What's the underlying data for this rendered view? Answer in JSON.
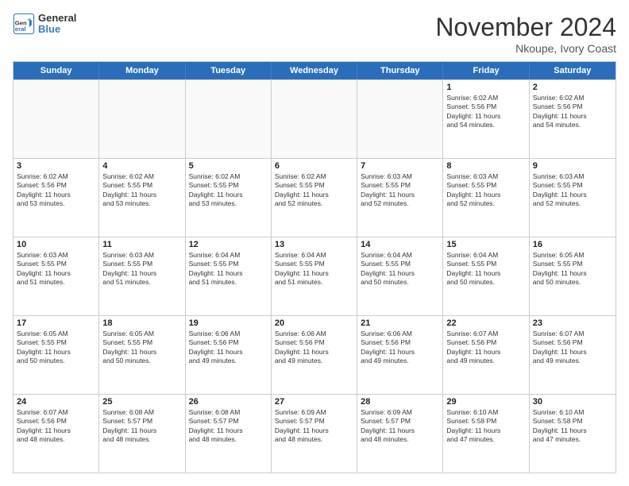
{
  "header": {
    "logo": {
      "line1": "General",
      "line2": "Blue"
    },
    "month": "November 2024",
    "location": "Nkoupe, Ivory Coast"
  },
  "weekdays": [
    "Sunday",
    "Monday",
    "Tuesday",
    "Wednesday",
    "Thursday",
    "Friday",
    "Saturday"
  ],
  "rows": [
    [
      {
        "day": "",
        "info": "",
        "empty": true
      },
      {
        "day": "",
        "info": "",
        "empty": true
      },
      {
        "day": "",
        "info": "",
        "empty": true
      },
      {
        "day": "",
        "info": "",
        "empty": true
      },
      {
        "day": "",
        "info": "",
        "empty": true
      },
      {
        "day": "1",
        "info": "Sunrise: 6:02 AM\nSunset: 5:56 PM\nDaylight: 11 hours\nand 54 minutes.",
        "empty": false
      },
      {
        "day": "2",
        "info": "Sunrise: 6:02 AM\nSunset: 5:56 PM\nDaylight: 11 hours\nand 54 minutes.",
        "empty": false
      }
    ],
    [
      {
        "day": "3",
        "info": "Sunrise: 6:02 AM\nSunset: 5:56 PM\nDaylight: 11 hours\nand 53 minutes.",
        "empty": false
      },
      {
        "day": "4",
        "info": "Sunrise: 6:02 AM\nSunset: 5:55 PM\nDaylight: 11 hours\nand 53 minutes.",
        "empty": false
      },
      {
        "day": "5",
        "info": "Sunrise: 6:02 AM\nSunset: 5:55 PM\nDaylight: 11 hours\nand 53 minutes.",
        "empty": false
      },
      {
        "day": "6",
        "info": "Sunrise: 6:02 AM\nSunset: 5:55 PM\nDaylight: 11 hours\nand 52 minutes.",
        "empty": false
      },
      {
        "day": "7",
        "info": "Sunrise: 6:03 AM\nSunset: 5:55 PM\nDaylight: 11 hours\nand 52 minutes.",
        "empty": false
      },
      {
        "day": "8",
        "info": "Sunrise: 6:03 AM\nSunset: 5:55 PM\nDaylight: 11 hours\nand 52 minutes.",
        "empty": false
      },
      {
        "day": "9",
        "info": "Sunrise: 6:03 AM\nSunset: 5:55 PM\nDaylight: 11 hours\nand 52 minutes.",
        "empty": false
      }
    ],
    [
      {
        "day": "10",
        "info": "Sunrise: 6:03 AM\nSunset: 5:55 PM\nDaylight: 11 hours\nand 51 minutes.",
        "empty": false
      },
      {
        "day": "11",
        "info": "Sunrise: 6:03 AM\nSunset: 5:55 PM\nDaylight: 11 hours\nand 51 minutes.",
        "empty": false
      },
      {
        "day": "12",
        "info": "Sunrise: 6:04 AM\nSunset: 5:55 PM\nDaylight: 11 hours\nand 51 minutes.",
        "empty": false
      },
      {
        "day": "13",
        "info": "Sunrise: 6:04 AM\nSunset: 5:55 PM\nDaylight: 11 hours\nand 51 minutes.",
        "empty": false
      },
      {
        "day": "14",
        "info": "Sunrise: 6:04 AM\nSunset: 5:55 PM\nDaylight: 11 hours\nand 50 minutes.",
        "empty": false
      },
      {
        "day": "15",
        "info": "Sunrise: 6:04 AM\nSunset: 5:55 PM\nDaylight: 11 hours\nand 50 minutes.",
        "empty": false
      },
      {
        "day": "16",
        "info": "Sunrise: 6:05 AM\nSunset: 5:55 PM\nDaylight: 11 hours\nand 50 minutes.",
        "empty": false
      }
    ],
    [
      {
        "day": "17",
        "info": "Sunrise: 6:05 AM\nSunset: 5:55 PM\nDaylight: 11 hours\nand 50 minutes.",
        "empty": false
      },
      {
        "day": "18",
        "info": "Sunrise: 6:05 AM\nSunset: 5:55 PM\nDaylight: 11 hours\nand 50 minutes.",
        "empty": false
      },
      {
        "day": "19",
        "info": "Sunrise: 6:06 AM\nSunset: 5:56 PM\nDaylight: 11 hours\nand 49 minutes.",
        "empty": false
      },
      {
        "day": "20",
        "info": "Sunrise: 6:06 AM\nSunset: 5:56 PM\nDaylight: 11 hours\nand 49 minutes.",
        "empty": false
      },
      {
        "day": "21",
        "info": "Sunrise: 6:06 AM\nSunset: 5:56 PM\nDaylight: 11 hours\nand 49 minutes.",
        "empty": false
      },
      {
        "day": "22",
        "info": "Sunrise: 6:07 AM\nSunset: 5:56 PM\nDaylight: 11 hours\nand 49 minutes.",
        "empty": false
      },
      {
        "day": "23",
        "info": "Sunrise: 6:07 AM\nSunset: 5:56 PM\nDaylight: 11 hours\nand 49 minutes.",
        "empty": false
      }
    ],
    [
      {
        "day": "24",
        "info": "Sunrise: 6:07 AM\nSunset: 5:56 PM\nDaylight: 11 hours\nand 48 minutes.",
        "empty": false
      },
      {
        "day": "25",
        "info": "Sunrise: 6:08 AM\nSunset: 5:57 PM\nDaylight: 11 hours\nand 48 minutes.",
        "empty": false
      },
      {
        "day": "26",
        "info": "Sunrise: 6:08 AM\nSunset: 5:57 PM\nDaylight: 11 hours\nand 48 minutes.",
        "empty": false
      },
      {
        "day": "27",
        "info": "Sunrise: 6:09 AM\nSunset: 5:57 PM\nDaylight: 11 hours\nand 48 minutes.",
        "empty": false
      },
      {
        "day": "28",
        "info": "Sunrise: 6:09 AM\nSunset: 5:57 PM\nDaylight: 11 hours\nand 48 minutes.",
        "empty": false
      },
      {
        "day": "29",
        "info": "Sunrise: 6:10 AM\nSunset: 5:58 PM\nDaylight: 11 hours\nand 47 minutes.",
        "empty": false
      },
      {
        "day": "30",
        "info": "Sunrise: 6:10 AM\nSunset: 5:58 PM\nDaylight: 11 hours\nand 47 minutes.",
        "empty": false
      }
    ]
  ]
}
